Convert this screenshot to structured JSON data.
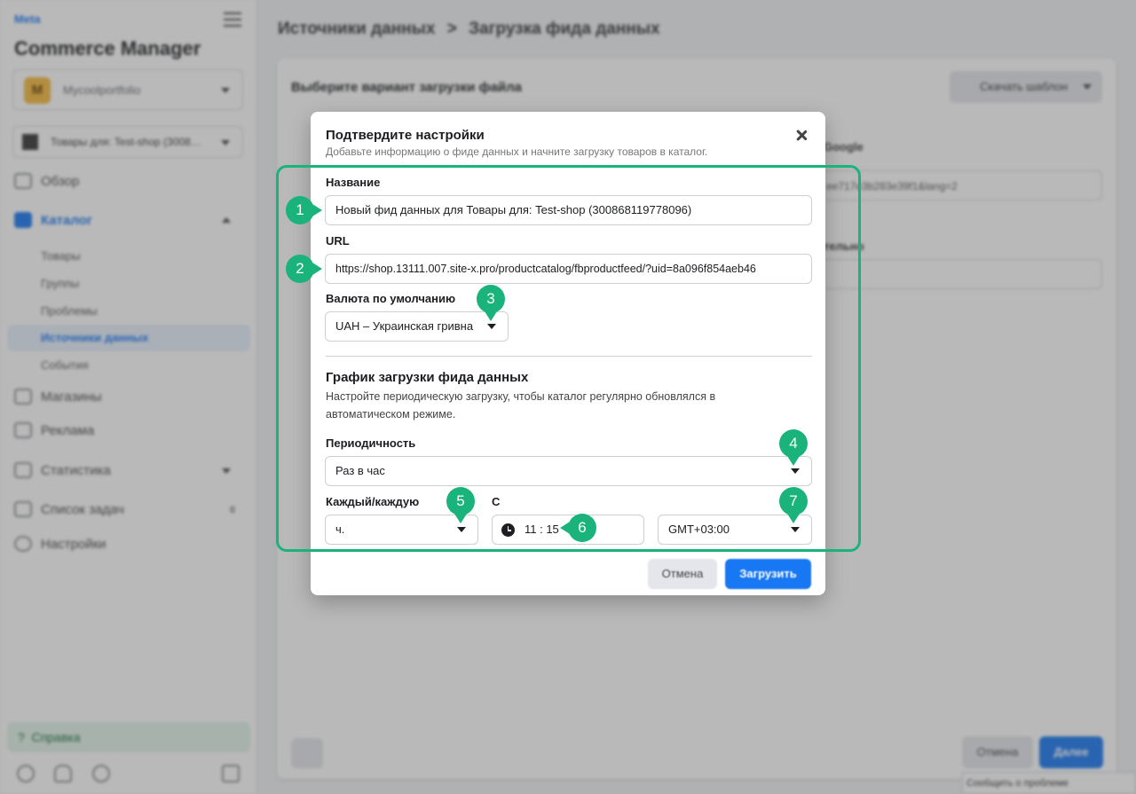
{
  "sidebar": {
    "brand": "Meta",
    "app_title": "Commerce Manager",
    "account": {
      "initial": "M",
      "name": "Mycoolportfolio"
    },
    "catalog": "Товары для: Test-shop (3008…",
    "nav": {
      "overview": "Обзор",
      "catalog": "Каталог",
      "catalog_sub": {
        "products": "Товары",
        "groups": "Группы",
        "problems": "Проблемы",
        "data_sources": "Источники данных",
        "events": "События"
      },
      "shops": "Магазины",
      "ads": "Реклама",
      "stats": "Статистика",
      "tasks": "Список задач",
      "tasks_count": "6",
      "settings": "Настройки"
    },
    "help": "Справка"
  },
  "breadcrumb": {
    "parent": "Источники данных",
    "separator": ">",
    "current": "Загрузка фида данных"
  },
  "main_card": {
    "title": "Выберите вариант загрузки файла",
    "template_button": "Скачать шаблон",
    "bg_label_google": "Google",
    "bg_url_fragment": "ee717e3b283e39f1&lang=2",
    "bg_label_2": "тельно",
    "cancel": "Отмена",
    "next": "Далее"
  },
  "report_problem": "Сообщить о проблеме",
  "modal": {
    "title": "Подтвердите настройки",
    "subtitle": "Добавьте информацию о фиде данных и начните загрузку товаров в каталог.",
    "name_label": "Название",
    "name_value": "Новый фид данных для Товары для: Test-shop (300868119778096)",
    "url_label": "URL",
    "url_value": "https://shop.13111.007.site-x.pro/productcatalog/fbproductfeed/?uid=8a096f854aeb46",
    "currency_label": "Валюта по умолчанию",
    "currency_value": "UAH – Украинская гривна",
    "schedule_title": "График загрузки фида данных",
    "schedule_desc": "Настройте периодическую загрузку, чтобы каталог регулярно обновлялся в автоматическом режиме.",
    "frequency_label": "Периодичность",
    "frequency_value": "Раз в час",
    "every_label": "Каждый/каждую",
    "every_value": "ч.",
    "from_label": "С",
    "time_value": "11 : 15",
    "timezone_value": "GMT+03:00",
    "cancel": "Отмена",
    "upload": "Загрузить"
  },
  "annotations": {
    "accent_color": "#1bb37c",
    "markers": [
      "1",
      "2",
      "3",
      "4",
      "5",
      "6",
      "7"
    ]
  }
}
